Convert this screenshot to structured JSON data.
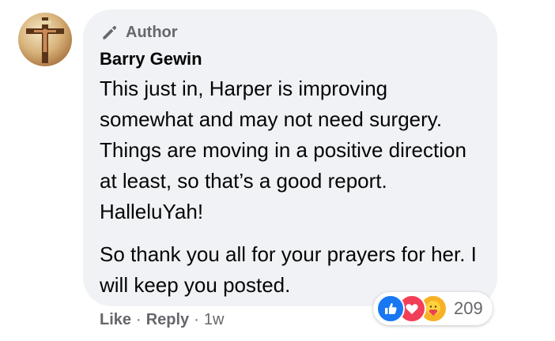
{
  "comment": {
    "badge_label": "Author",
    "author_name": "Barry Gewin",
    "paragraphs": [
      "This just in, Harper is improving somewhat and may not need surgery. Things are moving in a positive direction at least, so that’s a good report. HalleluYah!",
      "So thank you all for your prayers for her. I will keep you posted."
    ]
  },
  "reactions": {
    "icons": [
      "like-icon",
      "love-icon",
      "care-icon"
    ],
    "count": "209",
    "colors": {
      "like": "#1877f2",
      "love": "#f33e58",
      "care": "#f7b125"
    }
  },
  "actions": {
    "like_label": "Like",
    "separator": "·",
    "reply_label": "Reply",
    "timestamp": "1w"
  }
}
